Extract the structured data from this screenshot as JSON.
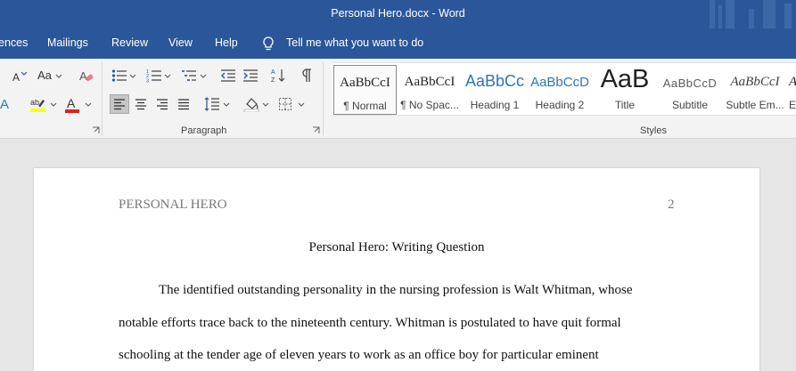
{
  "window": {
    "title": "Personal Hero.docx  -  Word"
  },
  "tabs": [
    "ences",
    "Mailings",
    "Review",
    "View",
    "Help"
  ],
  "tell_me": "Tell me what you want to do",
  "ribbon": {
    "groups": {
      "paragraph": "Paragraph",
      "styles": "Styles"
    },
    "change_case_label": "Aa"
  },
  "styles_gallery": [
    {
      "preview": "AaBbCcI",
      "name": "¶ Normal",
      "selected": true
    },
    {
      "preview": "AaBbCcI",
      "name": "¶ No Spac..."
    },
    {
      "preview": "AaBbCc",
      "name": "Heading 1"
    },
    {
      "preview": "AaBbCcD",
      "name": "Heading 2"
    },
    {
      "preview": "AaB",
      "name": "Title"
    },
    {
      "preview": "AaBbCcD",
      "name": "Subtitle"
    },
    {
      "preview": "AaBbCcI",
      "name": "Subtle Em..."
    },
    {
      "preview": "A",
      "name": "E"
    }
  ],
  "document": {
    "header_title": "PERSONAL HERO",
    "page_number": "2",
    "heading": "Personal Hero: Writing Question",
    "lines": [
      "The identified outstanding personality in the nursing profession is Walt Whitman, whose",
      "notable efforts trace back to the nineteenth century. Whitman is postulated to have quit formal",
      "schooling at the tender age of eleven years to work as an office boy for particular eminent"
    ]
  },
  "colors": {
    "accent": "#2b579a",
    "highlight": "#ffff00",
    "font_color": "#e0201e"
  }
}
